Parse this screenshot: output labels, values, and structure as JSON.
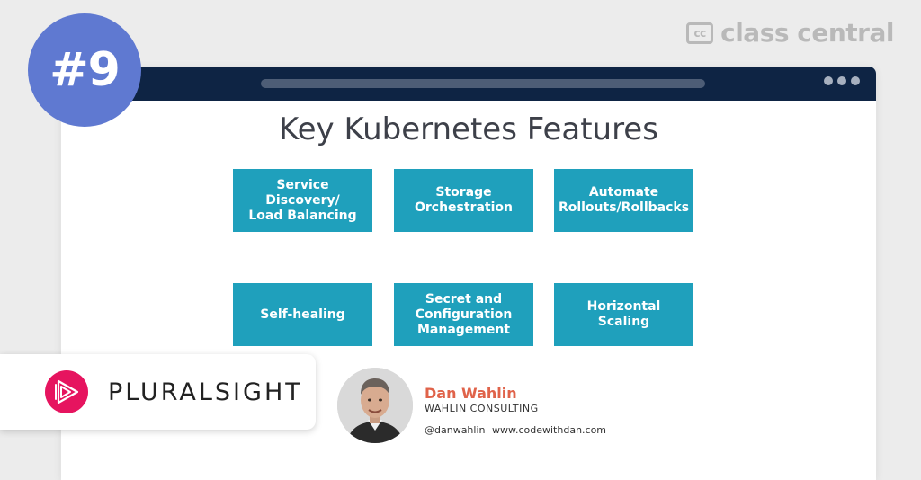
{
  "rank": "#9",
  "brand": {
    "logo_text": "cc",
    "name": "class central"
  },
  "slide": {
    "title": "Key Kubernetes Features",
    "features": [
      "Service Discovery/\nLoad Balancing",
      "Storage\nOrchestration",
      "Automate\nRollouts/Rollbacks",
      "Self-healing",
      "Secret and\nConfiguration\nManagement",
      "Horizontal Scaling"
    ]
  },
  "speaker": {
    "name": "Dan Wahlin",
    "company": "WAHLIN CONSULTING",
    "twitter": "@danwahlin",
    "website": "www.codewithdan.com"
  },
  "provider": {
    "name": "PLURALSIGHT"
  },
  "colors": {
    "badge": "#5f79d1",
    "titlebar": "#0e2444",
    "feature_box": "#1fa0bc",
    "speaker_name": "#e0634a",
    "pluralsight": "#e6145f"
  },
  "icons": {
    "window_controls": "more-dots-icon",
    "provider_logo": "pluralsight-play-icon",
    "brand_logo": "class-central-cc-icon"
  }
}
